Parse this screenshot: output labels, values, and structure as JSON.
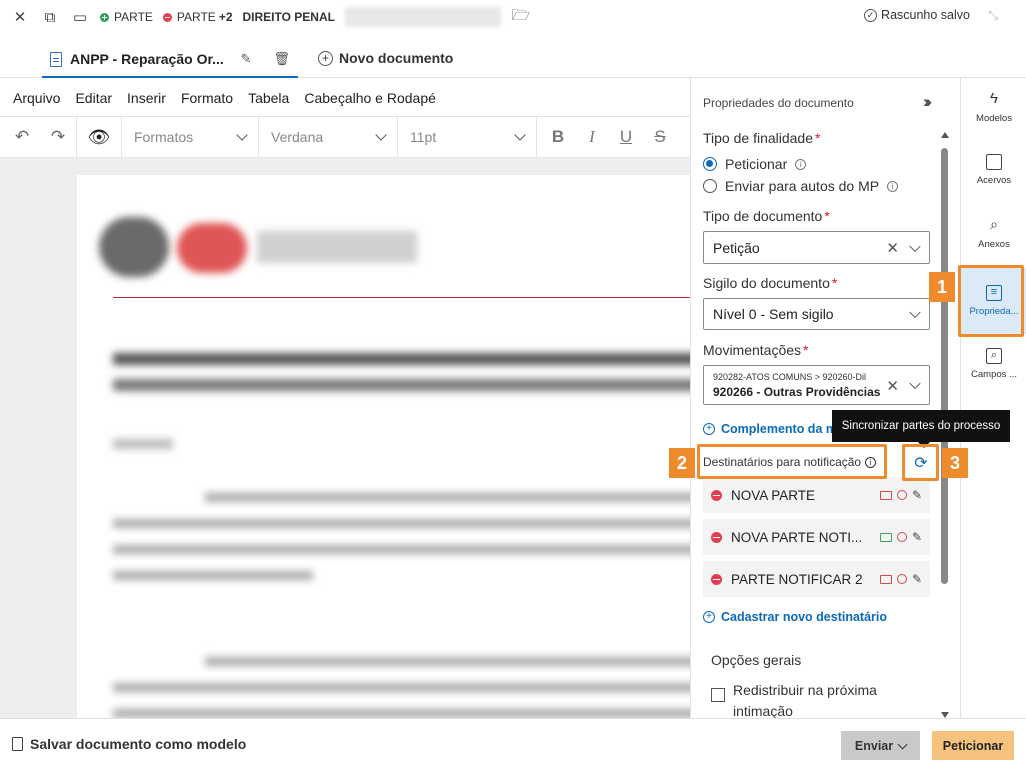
{
  "topbar": {
    "chips": [
      {
        "label": "PARTE",
        "status": "green"
      },
      {
        "label": "PARTE",
        "status": "red",
        "extra": "+2"
      }
    ],
    "category": "DIREITO PENAL",
    "draft_status": "Rascunho salvo"
  },
  "tabs": {
    "doc_title": "ANPP - Reparação Or...",
    "new_doc": "Novo documento"
  },
  "menubar": [
    "Arquivo",
    "Editar",
    "Inserir",
    "Formato",
    "Tabela",
    "Cabeçalho e Rodapé"
  ],
  "toolbar": {
    "formats": "Formatos",
    "font": "Verdana",
    "size": "11pt",
    "bold": "B",
    "italic": "I",
    "underline": "U",
    "strike": "S"
  },
  "panel": {
    "title": "Propriedades do documento",
    "finalidade_label": "Tipo de finalidade",
    "finalidade_options": [
      "Peticionar",
      "Enviar para autos do MP"
    ],
    "finalidade_selected": "Peticionar",
    "tipo_doc_label": "Tipo de documento",
    "tipo_doc_value": "Petição",
    "sigilo_label": "Sigilo do documento",
    "sigilo_value": "Nível 0 - Sem sigilo",
    "mov_label": "Movimentações",
    "mov_line1": "920282-ATOS COMUNS > 920260-Dil",
    "mov_line2": "920266 - Outras Providências",
    "complemento_link": "Complemento da m",
    "dest_label": "Destinatários para notificação",
    "destinatarios": [
      {
        "name": "NOVA PARTE",
        "mail_color": "#d24a4a"
      },
      {
        "name": "NOVA PARTE NOTI...",
        "mail_color": "#36a659"
      },
      {
        "name": "PARTE NOTIFICAR 2",
        "mail_color": "#d24a4a"
      }
    ],
    "cadastrar_link": "Cadastrar novo destinatário",
    "opcoes_label": "Opções gerais",
    "redistribuir_label": "Redistribuir na próxima intimação",
    "sync_tooltip": "Sincronizar partes do processo"
  },
  "callouts": [
    "1",
    "2",
    "3"
  ],
  "rail": [
    {
      "label": "Modelos",
      "icon": "lightning-icon"
    },
    {
      "label": "Acervos",
      "icon": "folder-icon"
    },
    {
      "label": "Anexos",
      "icon": "paperclip-icon"
    },
    {
      "label": "Proprieda...",
      "icon": "document-properties-icon",
      "active": true
    },
    {
      "label": "Campos ...",
      "icon": "search-document-icon"
    }
  ],
  "bottom": {
    "save_model": "Salvar documento como modelo",
    "enviar": "Enviar",
    "peticionar": "Peticionar"
  },
  "colors": {
    "accent": "#0b69b8",
    "callout": "#ee8b2c",
    "primary_button": "#f6c37e"
  }
}
